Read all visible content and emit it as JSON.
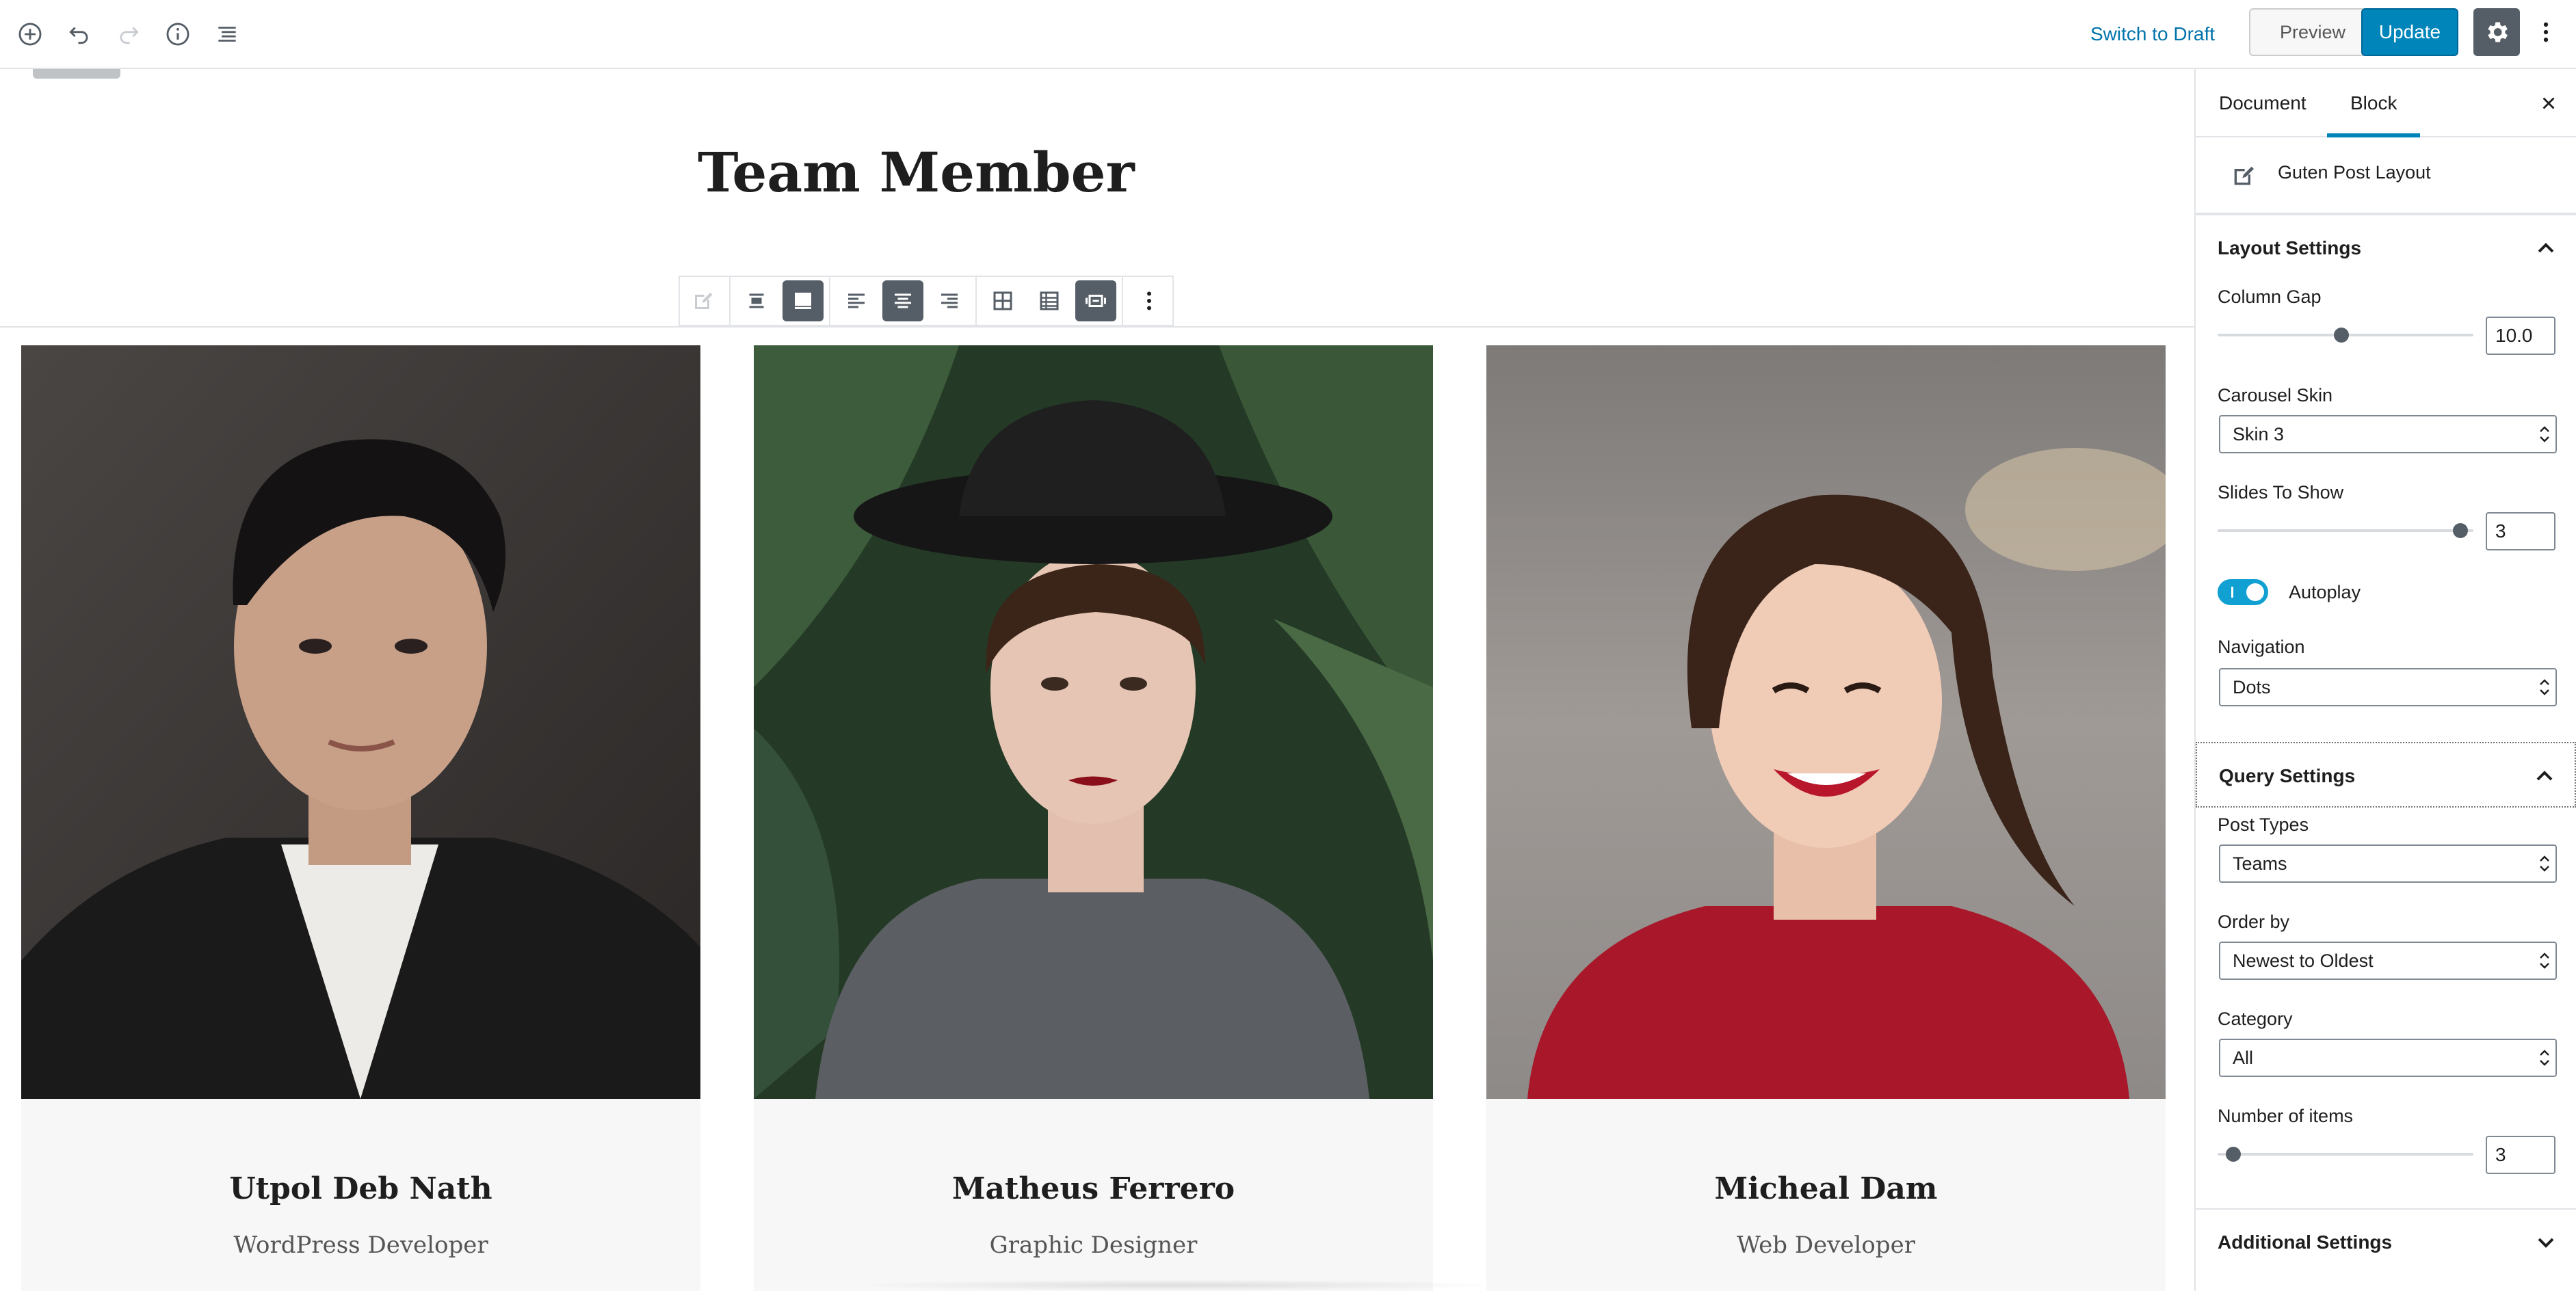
{
  "topbar": {
    "switch_to_draft": "Switch to Draft",
    "preview": "Preview",
    "update": "Update"
  },
  "editor": {
    "title": "Team Member",
    "members": [
      {
        "name": "Utpol Deb Nath",
        "role": "WordPress Developer"
      },
      {
        "name": "Matheus Ferrero",
        "role": "Graphic Designer"
      },
      {
        "name": "Micheal Dam",
        "role": "Web Developer"
      }
    ]
  },
  "sidebar": {
    "tabs": [
      "Document",
      "Block"
    ],
    "active_tab": "Block",
    "block_name": "Guten Post Layout",
    "layout_settings": {
      "title": "Layout Settings",
      "column_gap_label": "Column Gap",
      "column_gap_value": "10.0",
      "carousel_skin_label": "Carousel Skin",
      "carousel_skin_value": "Skin 3",
      "slides_to_show_label": "Slides To Show",
      "slides_to_show_value": "3",
      "autoplay_label": "Autoplay",
      "autoplay_on": true,
      "navigation_label": "Navigation",
      "navigation_value": "Dots"
    },
    "query_settings": {
      "title": "Query Settings",
      "post_types_label": "Post Types",
      "post_types_value": "Teams",
      "order_by_label": "Order by",
      "order_by_value": "Newest to Oldest",
      "category_label": "Category",
      "category_value": "All",
      "number_of_items_label": "Number of items",
      "number_of_items_value": "3"
    },
    "additional_settings": {
      "title": "Additional Settings"
    }
  },
  "colors": {
    "accent": "#0085ba",
    "link": "#0073aa",
    "toggle": "#11a0d2",
    "dark_button": "#555d66"
  }
}
